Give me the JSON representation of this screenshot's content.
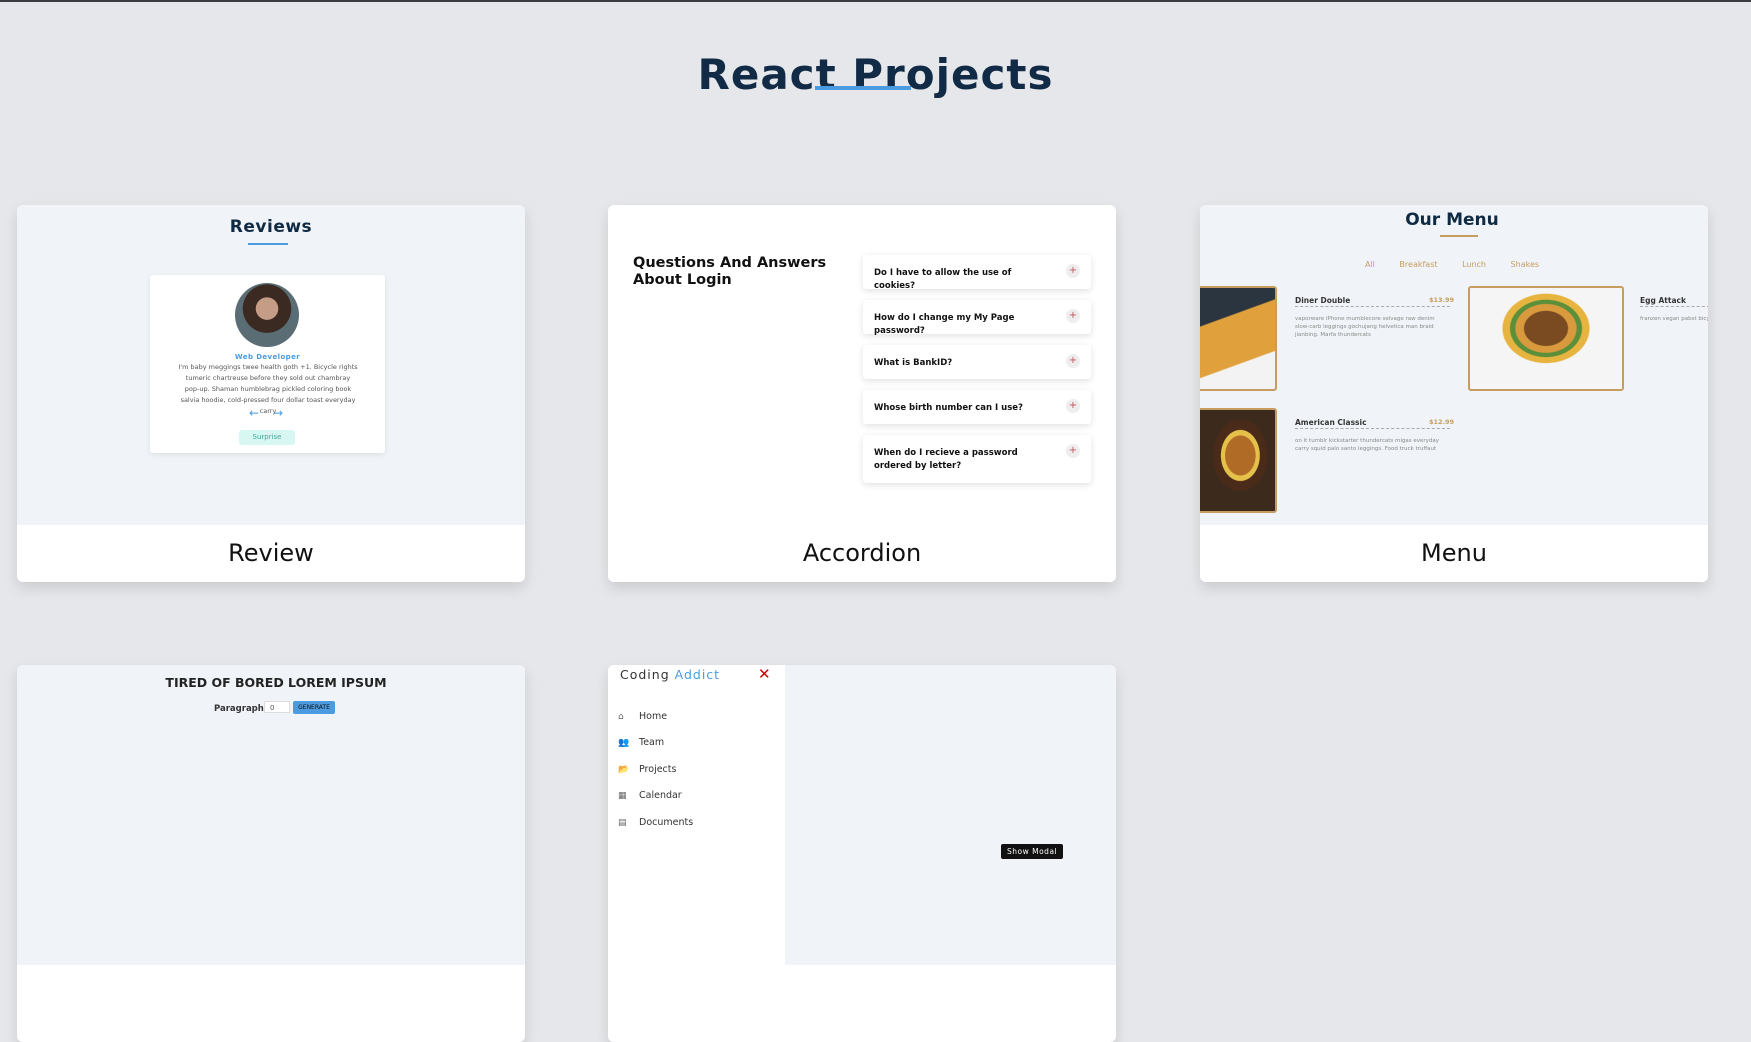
{
  "page": {
    "title": "React Projects"
  },
  "cards": [
    {
      "id": "review",
      "label": "Review",
      "preview": {
        "title": "Reviews",
        "job": "Web Developer",
        "text": "I'm baby meggings twee health goth +1. Bicycle rights tumeric chartreuse before they sold out chambray pop-up. Shaman humblebrag pickled coloring book salvia hoodie, cold-pressed four dollar toast everyday carry",
        "prev_icon": "arrow-left-icon",
        "next_icon": "arrow-right-icon",
        "surprise_label": "Surprise"
      }
    },
    {
      "id": "accordion",
      "label": "Accordion",
      "preview": {
        "heading": "Questions And Answers About Login",
        "questions": [
          "Do I have to allow the use of cookies?",
          "How do I change my My Page password?",
          "What is BankID?",
          "Whose birth number can I use?",
          "When do I recieve a password ordered by letter?"
        ],
        "toggle_symbol": "+"
      }
    },
    {
      "id": "menu",
      "label": "Menu",
      "preview": {
        "title": "Our Menu",
        "filters": [
          "All",
          "Breakfast",
          "Lunch",
          "Shakes"
        ],
        "items": [
          {
            "name": "Diner Double",
            "price": "$13.99",
            "desc": "vaporware iPhone mumblecore selvage raw denim slow-carb leggings gochujang helvetica man braid jianbing. Marfa thundercats"
          },
          {
            "name": "Egg Attack",
            "price": "",
            "desc": "franzen vegan pabst bicycle rights kickstarter pinterest meditation farm-to-table"
          },
          {
            "name": "American Classic",
            "price": "$12.99",
            "desc": "on it tumblr kickstarter thundercats migas everyday carry squid palo santo leggings. Food truck truffaut"
          }
        ]
      }
    },
    {
      "id": "lorem",
      "preview": {
        "title": "TIRED OF BORED LOREM IPSUM",
        "paragraph_label": "Paragraph:",
        "paragraph_value": "0",
        "generate_label": "GENERATE"
      }
    },
    {
      "id": "sidebar",
      "preview": {
        "logo_part1": "Coding",
        "logo_part2": "Addict",
        "close_symbol": "✕",
        "links": [
          {
            "label": "Home",
            "icon": "home-icon",
            "glyph": "⌂"
          },
          {
            "label": "Team",
            "icon": "team-icon",
            "glyph": "👥"
          },
          {
            "label": "Projects",
            "icon": "folder-icon",
            "glyph": "📂"
          },
          {
            "label": "Calendar",
            "icon": "calendar-icon",
            "glyph": "▦"
          },
          {
            "label": "Documents",
            "icon": "document-icon",
            "glyph": "▤"
          }
        ],
        "show_modal_label": "Show Modal"
      }
    }
  ],
  "colors": {
    "accent": "#4a9be0",
    "title": "#112a45",
    "menu_gold": "#c59d5f",
    "background": "#e6e7ea"
  }
}
